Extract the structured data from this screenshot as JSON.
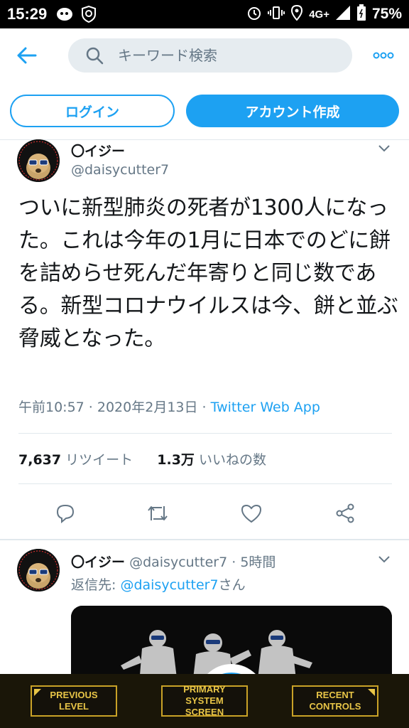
{
  "status_bar": {
    "time": "15:29",
    "network": "4G+",
    "battery": "75%"
  },
  "search": {
    "placeholder": "キーワード検索"
  },
  "auth": {
    "login_label": "ログイン",
    "signup_label": "アカウント作成"
  },
  "tweet": {
    "display_name": "〇イジー",
    "handle": "@daisycutter7",
    "text": "ついに新型肺炎の死者が1300人になった。これは今年の1月に日本でのどに餅を詰めらせ死んだ年寄りと同じ数である。新型コロナウイルスは今、餅と並ぶ脅威となった。",
    "timestamp": "午前10:57 · 2020年2月13日 · ",
    "source": "Twitter Web App",
    "retweet_count": "7,637",
    "retweet_label": "リツイート",
    "like_count": "1.3万",
    "like_label": "いいねの数"
  },
  "reply": {
    "display_name": "〇イジー",
    "handle": "@daisycutter7",
    "time_ago": "5時間",
    "reply_prefix": "返信先: ",
    "reply_mention": "@daisycutter7",
    "reply_suffix": "さん"
  },
  "overlay": {
    "previous_level": "PREVIOUS LEVEL",
    "primary_system_screen": "PRIMARY SYSTEM SCREEN",
    "recent_controls": "RECENT CONTROLS"
  },
  "colors": {
    "accent": "#1da1f2",
    "text_primary": "#14171a",
    "text_secondary": "#657786",
    "overlay_gold": "#c9a227"
  },
  "icons": {
    "back": "back-arrow-icon",
    "search": "search-icon",
    "more": "more-dots-icon",
    "reply": "reply-icon",
    "retweet": "retweet-icon",
    "like": "heart-icon",
    "share": "share-icon"
  }
}
